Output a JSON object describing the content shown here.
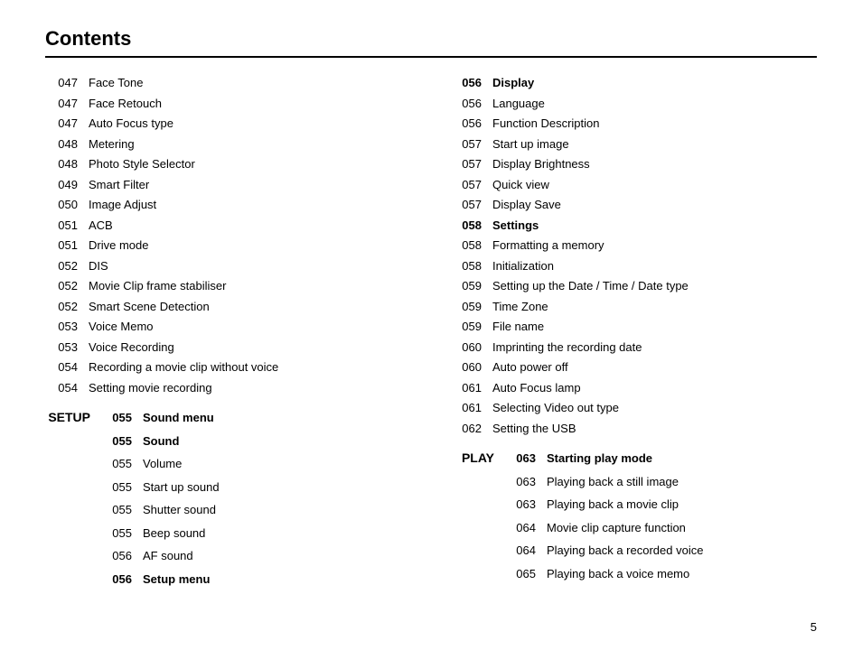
{
  "header": {
    "title": "Contents"
  },
  "left_col": {
    "entries": [
      {
        "page": "047",
        "label": "Face Tone",
        "bold": false
      },
      {
        "page": "047",
        "label": "Face Retouch",
        "bold": false
      },
      {
        "page": "047",
        "label": "Auto Focus type",
        "bold": false
      },
      {
        "page": "048",
        "label": "Metering",
        "bold": false
      },
      {
        "page": "048",
        "label": "Photo Style Selector",
        "bold": false
      },
      {
        "page": "049",
        "label": "Smart Filter",
        "bold": false
      },
      {
        "page": "050",
        "label": "Image Adjust",
        "bold": false
      },
      {
        "page": "051",
        "label": "ACB",
        "bold": false
      },
      {
        "page": "051",
        "label": "Drive mode",
        "bold": false
      },
      {
        "page": "052",
        "label": "DIS",
        "bold": false
      },
      {
        "page": "052",
        "label": "Movie Clip frame stabiliser",
        "bold": false
      },
      {
        "page": "052",
        "label": "Smart Scene Detection",
        "bold": false
      },
      {
        "page": "053",
        "label": "Voice Memo",
        "bold": false
      },
      {
        "page": "053",
        "label": "Voice Recording",
        "bold": false
      },
      {
        "page": "054",
        "label": "Recording a movie clip without voice",
        "bold": false
      },
      {
        "page": "054",
        "label": "Setting movie recording",
        "bold": false
      }
    ],
    "setup_section": "SETUP",
    "setup_entries": [
      {
        "page": "055",
        "label": "Sound menu",
        "bold": true
      },
      {
        "page": "055",
        "label": "Sound",
        "bold": true
      },
      {
        "page": "055",
        "label": "Volume",
        "bold": false
      },
      {
        "page": "055",
        "label": "Start up sound",
        "bold": false
      },
      {
        "page": "055",
        "label": "Shutter sound",
        "bold": false
      },
      {
        "page": "055",
        "label": "Beep sound",
        "bold": false
      },
      {
        "page": "056",
        "label": "AF sound",
        "bold": false
      },
      {
        "page": "056",
        "label": "Setup menu",
        "bold": true
      }
    ]
  },
  "right_col": {
    "display_section": {
      "page": "056",
      "label": "Display",
      "entries": [
        {
          "page": "056",
          "label": "Language",
          "bold": false
        },
        {
          "page": "056",
          "label": "Function Description",
          "bold": false
        },
        {
          "page": "057",
          "label": "Start up image",
          "bold": false
        },
        {
          "page": "057",
          "label": "Display Brightness",
          "bold": false
        },
        {
          "page": "057",
          "label": "Quick view",
          "bold": false
        },
        {
          "page": "057",
          "label": "Display Save",
          "bold": false
        }
      ]
    },
    "settings_section": {
      "page": "058",
      "label": "Settings",
      "entries": [
        {
          "page": "058",
          "label": "Formatting a memory",
          "bold": false
        },
        {
          "page": "058",
          "label": "Initialization",
          "bold": false
        },
        {
          "page": "059",
          "label": "Setting up the Date / Time / Date type",
          "bold": false
        },
        {
          "page": "059",
          "label": "Time Zone",
          "bold": false
        },
        {
          "page": "059",
          "label": "File name",
          "bold": false
        },
        {
          "page": "060",
          "label": "Imprinting the recording date",
          "bold": false
        },
        {
          "page": "060",
          "label": "Auto power off",
          "bold": false
        },
        {
          "page": "061",
          "label": "Auto Focus lamp",
          "bold": false
        },
        {
          "page": "061",
          "label": "Selecting Video out type",
          "bold": false
        },
        {
          "page": "062",
          "label": "Setting the USB",
          "bold": false
        }
      ]
    },
    "play_section": "PLAY",
    "play_entries": [
      {
        "page": "063",
        "label": "Starting play mode",
        "bold": true
      },
      {
        "page": "063",
        "label": "Playing back a still image",
        "bold": false
      },
      {
        "page": "063",
        "label": "Playing back a movie clip",
        "bold": false
      },
      {
        "page": "064",
        "label": "Movie clip capture function",
        "bold": false
      },
      {
        "page": "064",
        "label": "Playing back a recorded voice",
        "bold": false
      },
      {
        "page": "065",
        "label": "Playing back a voice memo",
        "bold": false
      }
    ]
  },
  "page_number": "5"
}
